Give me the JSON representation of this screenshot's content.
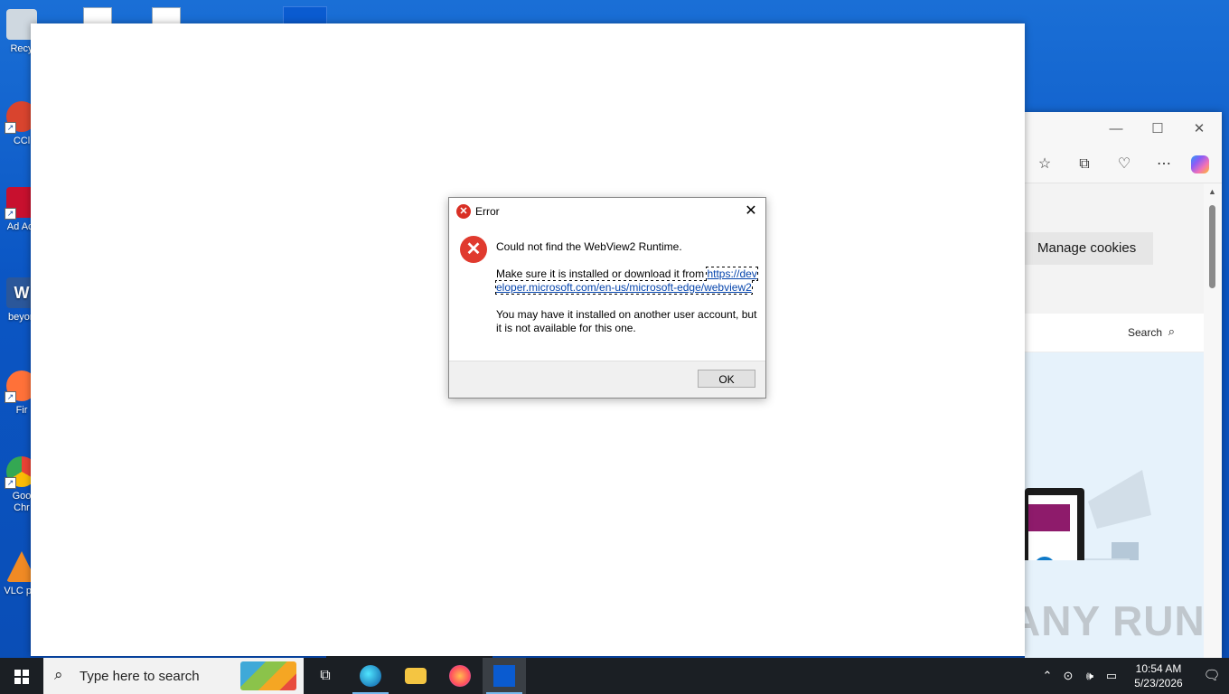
{
  "desktop": {
    "icons": [
      {
        "label": "Recy",
        "color": "#cfd8e0"
      },
      {
        "label": "CCl",
        "color": "#d9442e"
      },
      {
        "label": "Ad Acr",
        "color": "#c8102e"
      },
      {
        "label": "beyon",
        "color": "#2b579a"
      },
      {
        "label": "Fir",
        "color": "#ff7139"
      },
      {
        "label": "Goo Chr",
        "color": "#34a853"
      },
      {
        "label": "VLC pla",
        "color": "#f08a24"
      }
    ]
  },
  "edge": {
    "manage_cookies": "Manage cookies",
    "search_label": "Search",
    "minimize": "—",
    "maximize": "☐",
    "close": "✕"
  },
  "dialog": {
    "title": "Error",
    "message": "Could not find the WebView2 Runtime.",
    "install_prefix": "Make sure it is installed or download it from ",
    "install_link": "https://developer.microsoft.com/en-us/microsoft-edge/webview2",
    "note": "You may have it installed on another user account, but it is not available for this one.",
    "ok_label": "OK"
  },
  "taskbar": {
    "search_placeholder": "Type here to search",
    "time": "10:54 AM",
    "date": "5/23/2026"
  },
  "watermark": "ANY RUN"
}
